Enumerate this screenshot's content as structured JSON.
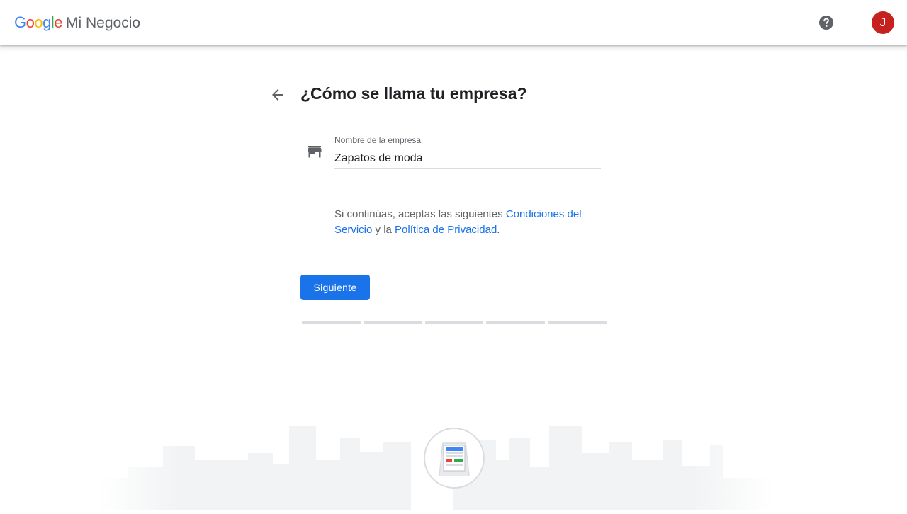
{
  "header": {
    "logo_google": [
      "G",
      "o",
      "o",
      "g",
      "l",
      "e"
    ],
    "logo_google_colors": [
      "#4285F4",
      "#EA4335",
      "#FBBC05",
      "#4285F4",
      "#34A853",
      "#EA4335"
    ],
    "product_name": "Mi Negocio",
    "help_icon": "help-circle-icon",
    "avatar_initial": "J",
    "avatar_color": "#c5221f"
  },
  "main": {
    "back_icon": "arrow-back-icon",
    "title": "¿Cómo se llama tu empresa?",
    "business_field": {
      "icon": "storefront-icon",
      "label": "Nombre de la empresa",
      "value": "Zapatos de moda"
    },
    "terms": {
      "prefix": "Si continúas, aceptas las siguientes ",
      "terms_link": "Condiciones del Servicio",
      "middle": " y la ",
      "privacy_link": "Política de Privacidad",
      "suffix": "."
    },
    "next_button": "Siguiente",
    "progress": {
      "total_steps": 5,
      "completed_steps": 0
    }
  },
  "colors": {
    "accent": "#1a73e8",
    "text_primary": "#202124",
    "text_secondary": "#5f6368",
    "divider": "#dadce0"
  }
}
